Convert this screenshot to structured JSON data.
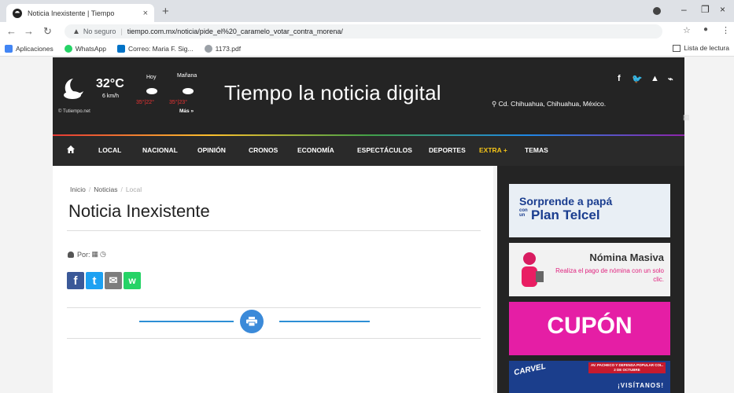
{
  "browser": {
    "tab_title": "Noticia Inexistente | Tiempo",
    "tab_close": "×",
    "new_tab": "+",
    "url_security": "No seguro",
    "url_separator": "|",
    "url": "tiempo.com.mx/noticia/pide_el%20_caramelo_votar_contra_morena/",
    "win_minimize": "–",
    "win_restore": "❐",
    "win_close": "×",
    "bookmarks": [
      {
        "label": "Aplicaciones",
        "color": "#4285f4"
      },
      {
        "label": "WhatsApp",
        "color": "#25d366"
      },
      {
        "label": "Correo: Maria F. Sig...",
        "color": "#0072c6"
      },
      {
        "label": "1173.pdf",
        "color": "#9aa0a6"
      }
    ],
    "reading_list": "Lista de lectura"
  },
  "header": {
    "weather": {
      "temp": "32°C",
      "wind": "6 km/h",
      "site": "© Tutiempo.net",
      "today_label": "Hoy",
      "today_range": "35°|22°",
      "tomorrow_label": "Mañana",
      "tomorrow_range": "35°|23°",
      "more": "Más »"
    },
    "site_title": "Tiempo la noticia digital",
    "location": "Cd. Chihuahua, Chihuahua, México.",
    "social": [
      "f",
      "🐦",
      "▲",
      "⌁"
    ]
  },
  "nav": {
    "items": [
      "LOCAL",
      "NACIONAL",
      "OPINIÓN",
      "CRONOS",
      "ECONOMÍA",
      "ESPECTÁCULOS",
      "DEPORTES",
      "EXTRA +",
      "TEMAS"
    ]
  },
  "article": {
    "breadcrumb": [
      "Inicio",
      "Noticias",
      "Local"
    ],
    "title": "Noticia Inexistente",
    "byline": "Por:",
    "share": [
      "f",
      "t",
      "✉",
      "w"
    ]
  },
  "sidebar": {
    "ad1": {
      "line1": "Sorprende a papá",
      "con": "con",
      "un": "un",
      "line2": "Plan Telcel"
    },
    "ad2": {
      "title": "Nómina Masiva",
      "body": "Realiza el pago de nómina con un solo clic."
    },
    "ad3": {
      "title": "CUPÓN"
    },
    "ad4": {
      "brand": "CARVEL",
      "promo": "AV. PACHECO Y DEFENSA POPULAR COL. 2 DE OCTUBRE",
      "cta": "¡VISÍTANOS!"
    }
  }
}
